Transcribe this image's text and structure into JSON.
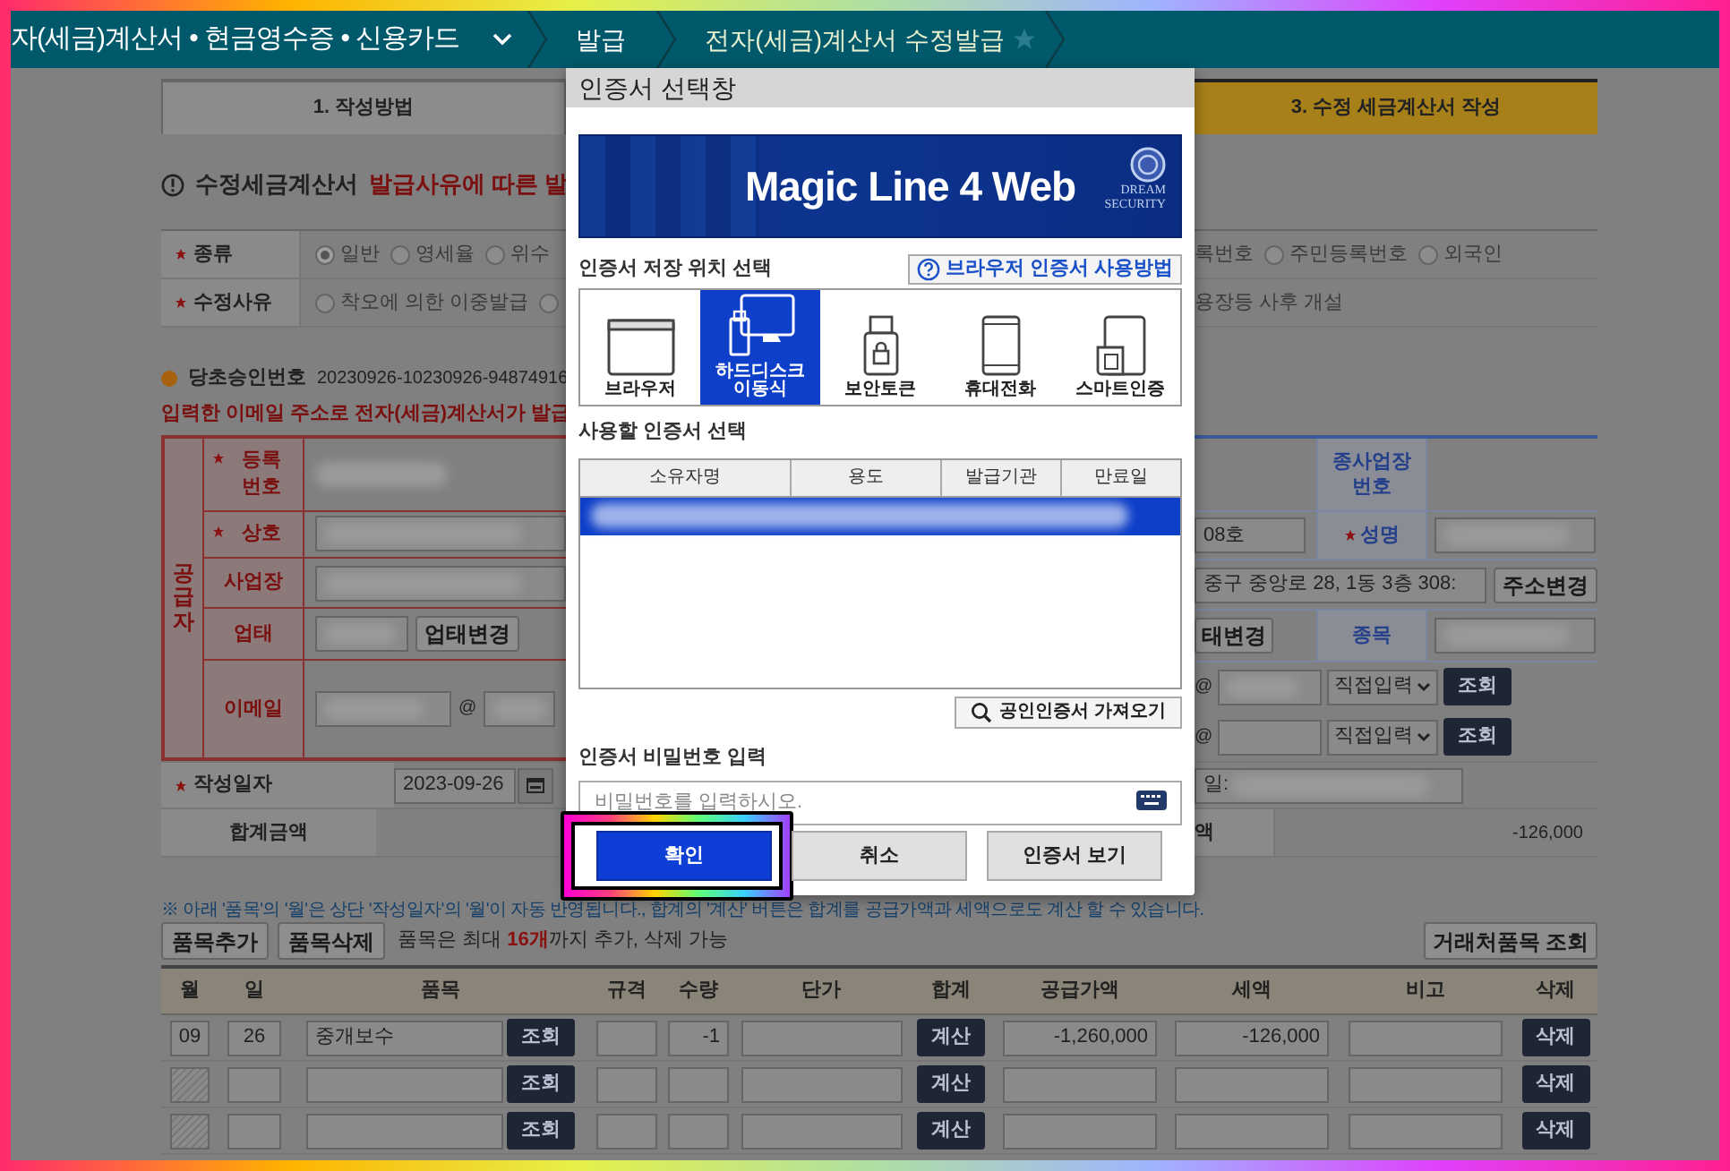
{
  "nav": {
    "section": "자(세금)계산서 • 현금영수증 • 신용카드",
    "crumbs": [
      "발급",
      "전자(세금)계산서 수정발급"
    ]
  },
  "steps": [
    {
      "label": "1. 작성방법",
      "selected": false
    },
    {
      "label": "3. 수정 세금계산서 작성",
      "selected": true
    }
  ],
  "heading": {
    "text": "수정세금계산서",
    "highlight": "발급사유에 따른 발"
  },
  "options": [
    {
      "label": "종류",
      "required": true,
      "left": [
        {
          "kind": "radio",
          "label": "일반",
          "selected": true
        },
        {
          "kind": "radio",
          "label": "영세율",
          "selected": false
        },
        {
          "kind": "radio",
          "label": "위수",
          "selected": false
        }
      ],
      "right": [
        {
          "kind": "text",
          "label": "록번호"
        },
        {
          "kind": "radio",
          "label": "주민등록번호",
          "selected": false
        },
        {
          "kind": "radio",
          "label": "외국인",
          "selected": false
        }
      ]
    },
    {
      "label": "수정사유",
      "required": true,
      "left": [
        {
          "kind": "radio",
          "label": "착오에 의한 이중발급",
          "selected": false
        },
        {
          "kind": "bare-radio",
          "selected": false
        }
      ],
      "right": [
        {
          "kind": "text",
          "label": "용장등 사후 개설"
        }
      ]
    }
  ],
  "original_approval": {
    "label": "당초승인번호",
    "value": "20230926-10230926-94874916"
  },
  "email_notice": "입력한 이메일 주소로 전자(세금)계산서가 발급",
  "supplier": {
    "group_label": "공급자",
    "left": [
      {
        "label": "등록 번호",
        "required": true,
        "kind": "redacted"
      },
      {
        "label": "상호",
        "required": true,
        "kind": "field"
      },
      {
        "label": "사업장",
        "required": false,
        "kind": "field"
      },
      {
        "label": "업태",
        "required": false,
        "kind": "field-button",
        "button": "업태변경"
      },
      {
        "label": "이메일",
        "required": false,
        "kind": "email",
        "at": "@"
      }
    ],
    "right": {
      "branch_label": "종사업장 번호",
      "unit": "08호",
      "name_label": "성명",
      "name_required": true,
      "address": "중구 중앙로 28, 1동 3층 308:",
      "address_button": "주소변경",
      "type_button": "태변경",
      "item_label": "종목",
      "emails": [
        {
          "at": "@",
          "domain": "직접입력",
          "button": "조회",
          "filled": true
        },
        {
          "at": "@",
          "domain": "직접입력",
          "button": "조회",
          "filled": false
        }
      ]
    }
  },
  "write_date": {
    "label": "작성일자",
    "required": true,
    "value": "2023-09-26",
    "right_label": "일:"
  },
  "total": {
    "label": "합계금액",
    "right_label": "액",
    "value": "-126,000"
  },
  "note": "※ 아래 '품목'의 '월'은 상단 '작성일자'의 '월'이 자동 반영됩니다., 합계의 '계산' 버튼은 합계를 공급가액과 세액으로도 계산 할 수 있습니다.",
  "item_actions": {
    "add": "품목추가",
    "remove": "품목삭제",
    "hint": "품목은 최대 **16개**까지 추가, 삭제 가능",
    "lookup": "거래처품목 조회"
  },
  "items": {
    "columns": [
      "월",
      "일",
      "품목",
      "규격",
      "수량",
      "단가",
      "합계",
      "공급가액",
      "세액",
      "비고",
      "삭제"
    ],
    "rows": [
      {
        "month": "09",
        "day": "26",
        "name": "중개보수",
        "lookup": "조회",
        "spec": "",
        "qty": "-1",
        "price": "",
        "calc": "계산",
        "supply": "-1,260,000",
        "tax": "-126,000",
        "memo": "",
        "delete": "삭제"
      },
      {
        "lookup": "조회",
        "calc": "계산",
        "delete": "삭제"
      },
      {
        "lookup": "조회",
        "calc": "계산",
        "delete": "삭제"
      }
    ]
  },
  "dialog": {
    "title": "인증서 선택창",
    "banner": {
      "product": "Magic Line 4 Web",
      "vendor_top": "DREAM",
      "vendor_bottom": "SECURITY"
    },
    "storage_label": "인증서 저장 위치 선택",
    "help_button": "브라우저 인증서 사용방법",
    "locations": [
      {
        "kind": "browser",
        "label": "브라우저",
        "selected": false
      },
      {
        "kind": "disk",
        "label": "하드디스크 이동식",
        "selected": true
      },
      {
        "kind": "token",
        "label": "보안토큰",
        "selected": false
      },
      {
        "kind": "phone",
        "label": "휴대전화",
        "selected": false
      },
      {
        "kind": "smart",
        "label": "스마트인증",
        "selected": false
      }
    ],
    "cert_label": "사용할 인증서 선택",
    "cert_columns": [
      "소유자명",
      "용도",
      "발급기관",
      "만료일"
    ],
    "certificates": [
      {
        "selected": true
      }
    ],
    "import_button": "공인인증서 가져오기",
    "password_label": "인증서 비밀번호 입력",
    "password_placeholder": "비밀번호를 입력하시오.",
    "buttons": [
      {
        "kind": "primary",
        "label": "확인",
        "highlighted": true
      },
      {
        "kind": "default",
        "label": "취소",
        "highlighted": false
      },
      {
        "kind": "default",
        "label": "인증서 보기",
        "highlighted": false
      }
    ]
  }
}
